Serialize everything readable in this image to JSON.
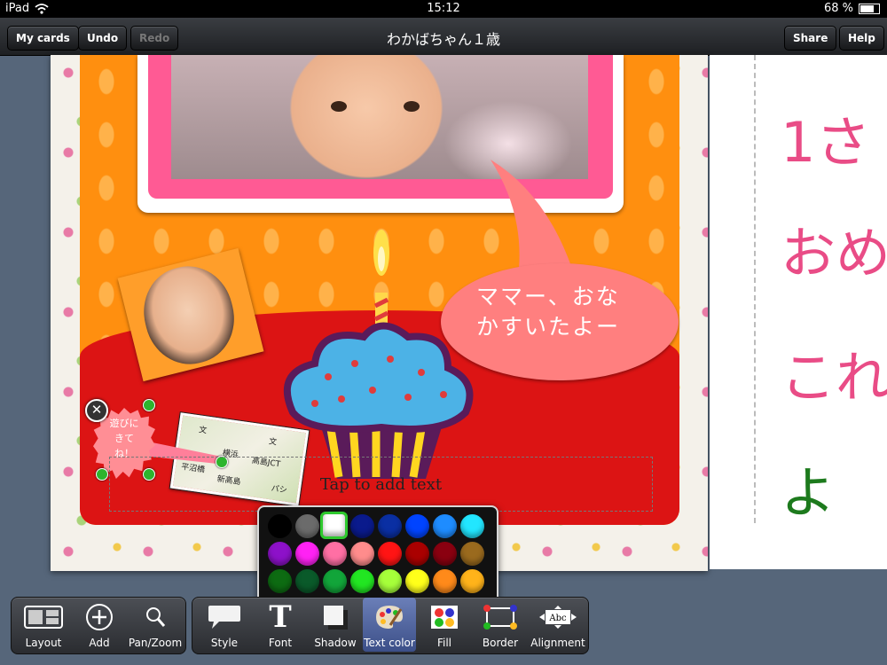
{
  "status_bar": {
    "device": "iPad",
    "time": "15:12",
    "battery": "68 %",
    "battery_level": 0.68
  },
  "toolbar": {
    "my_cards": "My cards",
    "undo": "Undo",
    "redo": "Redo",
    "title": "わかばちゃん１歳",
    "share": "Share",
    "help": "Help"
  },
  "card": {
    "balloon_line1": "ママー、おな",
    "balloon_line2": "かすいたよー",
    "star_line1": "遊びに",
    "star_line2": "きて",
    "star_line3": "ね！",
    "textbox_placeholder": "Tap to add text",
    "map_labels": [
      "文",
      "横浜",
      "平沼橋",
      "新高島",
      "高島JCT",
      "文",
      "パシ"
    ]
  },
  "right_page": {
    "line1": "1さ",
    "line2": "おめ",
    "line3": "これ",
    "line4": "よ"
  },
  "colors": {
    "accent_selected": "#2ec92e",
    "swatches": [
      [
        "#000000",
        "#6b6b6b",
        "#ffffff",
        "#0a1a8c",
        "#0a2fa3",
        "#0044ff",
        "#1e8cff",
        "#22e6ff"
      ],
      [
        "#8d11c9",
        "#ff22f4",
        "#ff6fa4",
        "#ff8c8c",
        "#ff1414",
        "#aa0000",
        "#8a0010",
        "#9a6a1e"
      ],
      [
        "#0d6b12",
        "#0a5a2a",
        "#12a53a",
        "#22e622",
        "#a6ff3a",
        "#ffff1a",
        "#ff8a1a",
        "#ffb31a"
      ]
    ],
    "selected_swatch": "#ffffff"
  },
  "bottom_tools_left": [
    {
      "label": "Layout",
      "icon": "layout-icon"
    },
    {
      "label": "Add",
      "icon": "add-circle-icon"
    },
    {
      "label": "Pan/Zoom",
      "icon": "magnifier-icon"
    }
  ],
  "bottom_tools_right": [
    {
      "label": "Style",
      "icon": "speech-bubble-icon"
    },
    {
      "label": "Font",
      "icon": "font-t-icon"
    },
    {
      "label": "Shadow",
      "icon": "shadow-square-icon"
    },
    {
      "label": "Text color",
      "icon": "palette-icon",
      "active": true
    },
    {
      "label": "Fill",
      "icon": "fill-dots-icon"
    },
    {
      "label": "Border",
      "icon": "border-icon"
    },
    {
      "label": "Alignment",
      "icon": "alignment-icon"
    }
  ]
}
